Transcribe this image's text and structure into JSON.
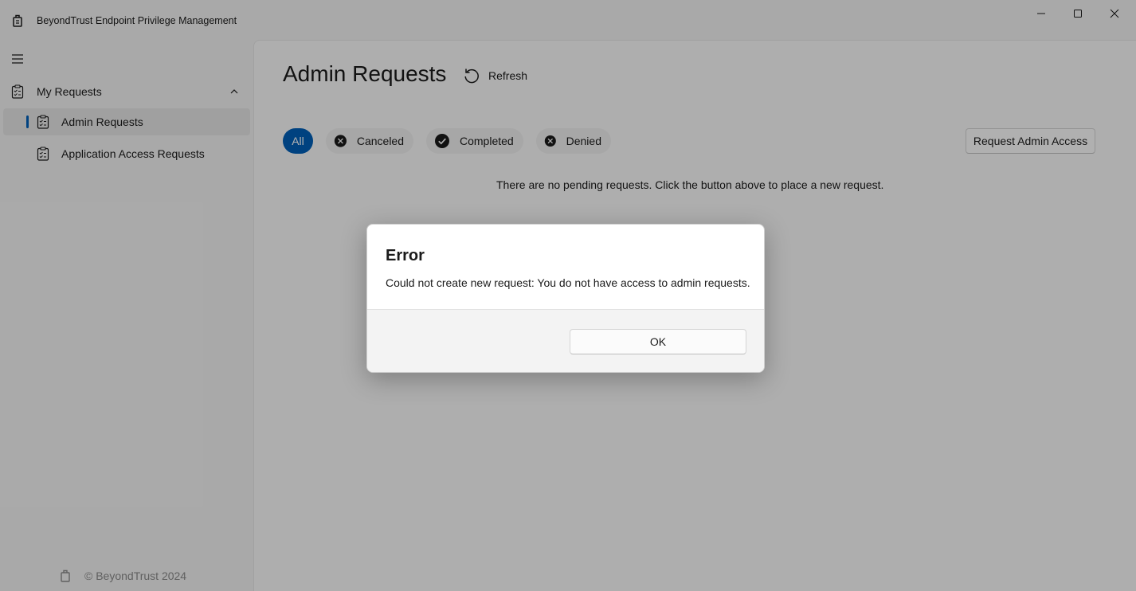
{
  "window": {
    "title": "BeyondTrust Endpoint Privilege Management"
  },
  "sidebar": {
    "group_label": "My Requests",
    "items": [
      {
        "label": "Admin Requests",
        "selected": true
      },
      {
        "label": "Application Access Requests",
        "selected": false
      }
    ],
    "footer": "© BeyondTrust 2024"
  },
  "main": {
    "title": "Admin Requests",
    "refresh_label": "Refresh",
    "filters": {
      "all": "All",
      "canceled": "Canceled",
      "completed": "Completed",
      "denied": "Denied"
    },
    "request_button": "Request Admin Access",
    "empty_message": "There are no pending requests. Click the button above to place a new request."
  },
  "dialog": {
    "title": "Error",
    "message": "Could not create new request: You do not have access to admin requests.",
    "ok_label": "OK"
  },
  "colors": {
    "accent": "#005fb8"
  }
}
